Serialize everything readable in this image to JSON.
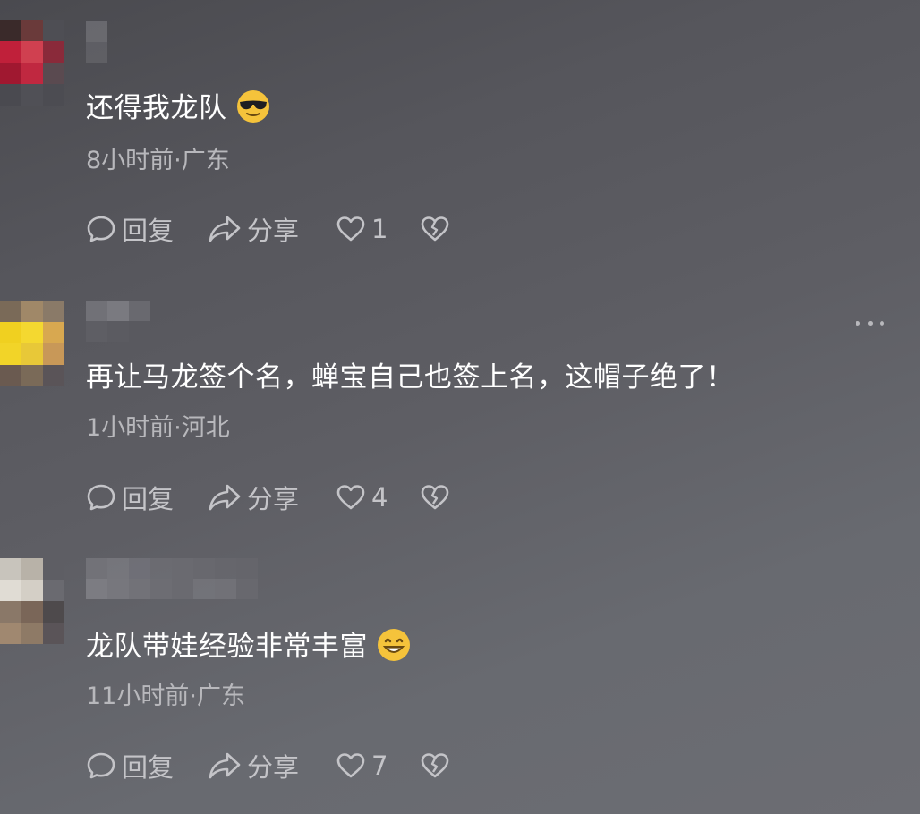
{
  "comments": [
    {
      "text": "还得我龙队",
      "emoji": "sunglasses-emoji",
      "time_location": "8小时前·广东",
      "reply_label": "回复",
      "share_label": "分享",
      "like_count": "1"
    },
    {
      "text": "再让马龙签个名，蝉宝自己也签上名，这帽子绝了！",
      "emoji": "",
      "time_location": "1小时前·河北",
      "reply_label": "回复",
      "share_label": "分享",
      "like_count": "4"
    },
    {
      "text": "龙队带娃经验非常丰富",
      "emoji": "grinning-emoji",
      "time_location": "11小时前·广东",
      "reply_label": "回复",
      "share_label": "分享",
      "like_count": "7"
    }
  ],
  "icons": {
    "reply": "speech-bubble-icon",
    "share": "share-arrow-icon",
    "like": "heart-icon",
    "dislike": "broken-heart-icon",
    "more": "more-dots-icon"
  },
  "colors": {
    "text_primary": "#ffffff",
    "text_secondary": "#b8b8bc",
    "action_gray": "#c4c4c8",
    "emoji_yellow": "#f5c33b"
  }
}
